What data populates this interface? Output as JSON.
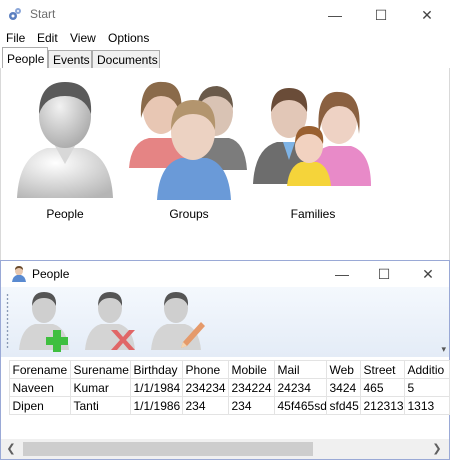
{
  "window": {
    "title": "Start",
    "icon": "gears-icon",
    "minimize_glyph": "—",
    "maximize_glyph": "☐",
    "close_glyph": "✕"
  },
  "menu": [
    "File",
    "Edit",
    "View",
    "Options"
  ],
  "tabs": [
    {
      "label": "People",
      "active": true
    },
    {
      "label": "Events",
      "active": false
    },
    {
      "label": "Documents",
      "active": false
    }
  ],
  "people_panel": {
    "items": [
      {
        "label": "People",
        "icon": "person-icon"
      },
      {
        "label": "Groups",
        "icon": "group-icon"
      },
      {
        "label": "Families",
        "icon": "family-icon"
      }
    ]
  },
  "child_window": {
    "title": "People",
    "icon": "person-small-icon",
    "minimize_glyph": "—",
    "maximize_glyph": "☐",
    "close_glyph": "✕",
    "toolbar": [
      {
        "name": "add-person",
        "icon": "add-person-icon"
      },
      {
        "name": "delete-person",
        "icon": "delete-person-icon"
      },
      {
        "name": "edit-person",
        "icon": "edit-person-icon"
      }
    ],
    "chevron": "▾"
  },
  "table": {
    "columns": [
      "Forename",
      "Surename",
      "Birthday",
      "Phone",
      "Mobile",
      "Mail",
      "Web",
      "Street",
      "Additio"
    ],
    "rows": [
      [
        "Naveen",
        "Kumar",
        "1/1/1984",
        "234234",
        "234224",
        "24234",
        "3424",
        "465",
        "5"
      ],
      [
        "Dipen",
        "Tanti",
        "1/1/1986",
        "234",
        "234",
        "45f465sd",
        "sfd45",
        "212313",
        "1313"
      ]
    ]
  },
  "scrollbar": {
    "left_arrow": "❮",
    "right_arrow": "❯"
  },
  "colors": {
    "accent_border": "#9aa9d6",
    "toolbar_bg": "#e4ecf7",
    "plus_green": "#3fbf3f",
    "delete_red": "#e06666"
  }
}
